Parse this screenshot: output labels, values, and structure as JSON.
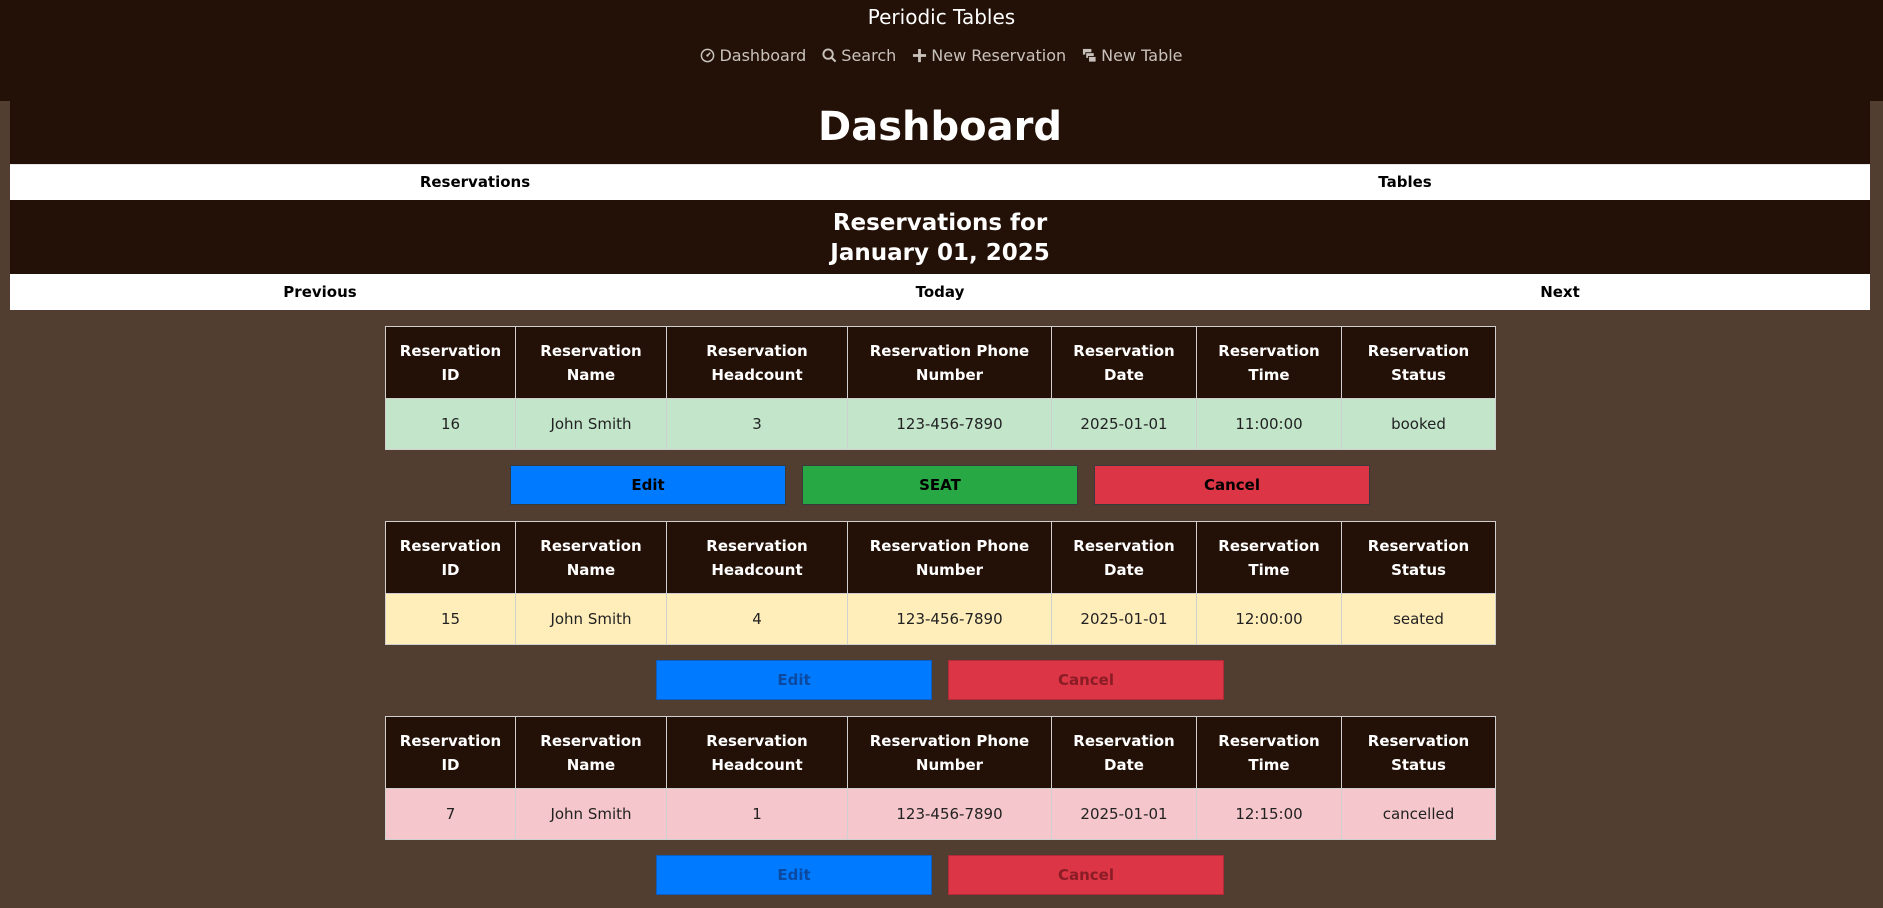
{
  "app": {
    "title": "Periodic Tables"
  },
  "nav": [
    {
      "label": "Dashboard",
      "icon": "dashboard-icon"
    },
    {
      "label": "Search",
      "icon": "search-icon"
    },
    {
      "label": "New Reservation",
      "icon": "plus-icon"
    },
    {
      "label": "New Table",
      "icon": "table-icon"
    }
  ],
  "page": {
    "title": "Dashboard"
  },
  "section_tabs": {
    "reservations": "Reservations",
    "tables": "Tables"
  },
  "reservations_heading": {
    "line1": "Reservations for",
    "line2": "January 01, 2025"
  },
  "date_nav": {
    "previous": "Previous",
    "today": "Today",
    "next": "Next"
  },
  "table_headers": [
    "Reservation ID",
    "Reservation Name",
    "Reservation Headcount",
    "Reservation Phone Number",
    "Reservation Date",
    "Reservation Time",
    "Reservation Status"
  ],
  "reservations": [
    {
      "id": "16",
      "name": "John Smith",
      "headcount": "3",
      "phone": "123-456-7890",
      "date": "2025-01-01",
      "time": "11:00:00",
      "status": "booked",
      "buttons": {
        "edit": "Edit",
        "seat": "SEAT",
        "cancel": "Cancel"
      }
    },
    {
      "id": "15",
      "name": "John Smith",
      "headcount": "4",
      "phone": "123-456-7890",
      "date": "2025-01-01",
      "time": "12:00:00",
      "status": "seated",
      "buttons": {
        "edit": "Edit",
        "cancel": "Cancel"
      }
    },
    {
      "id": "7",
      "name": "John Smith",
      "headcount": "1",
      "phone": "123-456-7890",
      "date": "2025-01-01",
      "time": "12:15:00",
      "status": "cancelled",
      "buttons": {
        "edit": "Edit",
        "cancel": "Cancel"
      }
    }
  ],
  "colors": {
    "header_bg": "#231107",
    "page_bg": "#523e30",
    "booked_row": "#c3e6cb",
    "seated_row": "#ffeeba",
    "cancelled_row": "#f5c6cb",
    "edit_button": "#007bff",
    "seat_button": "#28a745",
    "cancel_button": "#dc3545"
  }
}
